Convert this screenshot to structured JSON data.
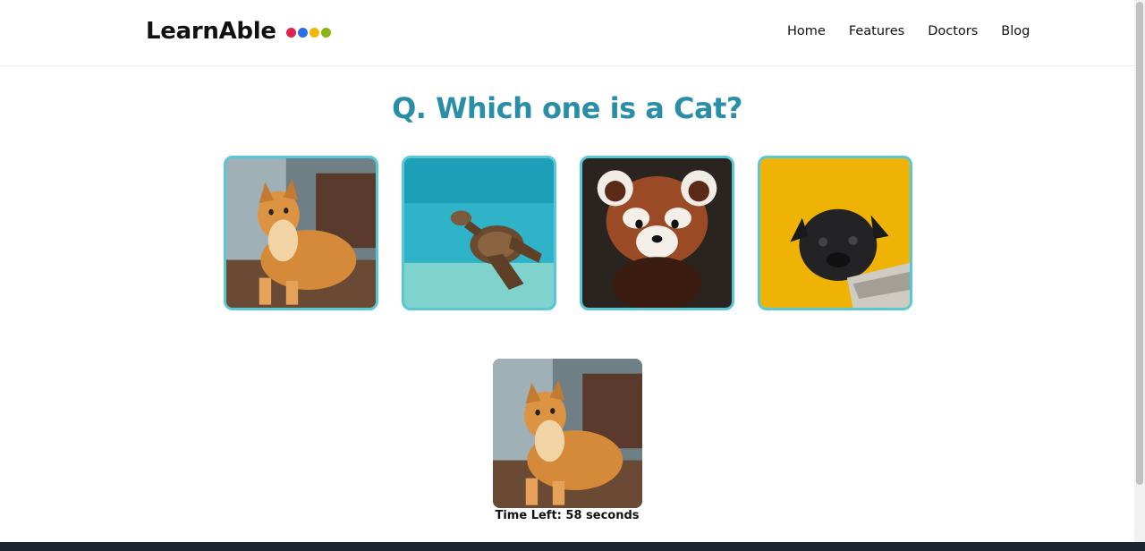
{
  "brand": {
    "name": "LearnAble",
    "dot_colors": [
      "#e0234e",
      "#2c6ce6",
      "#f2b705",
      "#8ab414"
    ]
  },
  "nav": {
    "items": [
      {
        "label": "Home"
      },
      {
        "label": "Features"
      },
      {
        "label": "Doctors"
      },
      {
        "label": "Blog"
      }
    ]
  },
  "quiz": {
    "question": "Q. Which one is a Cat?",
    "options": [
      {
        "image": "cat-photo"
      },
      {
        "image": "sea-turtle-photo"
      },
      {
        "image": "red-panda-photo"
      },
      {
        "image": "pug-photo"
      }
    ],
    "selected_image": "cat-photo",
    "timer_text": "Time Left: 58 seconds"
  },
  "colors": {
    "accent": "#2a8ea8",
    "option_border": "#58c8d6"
  }
}
